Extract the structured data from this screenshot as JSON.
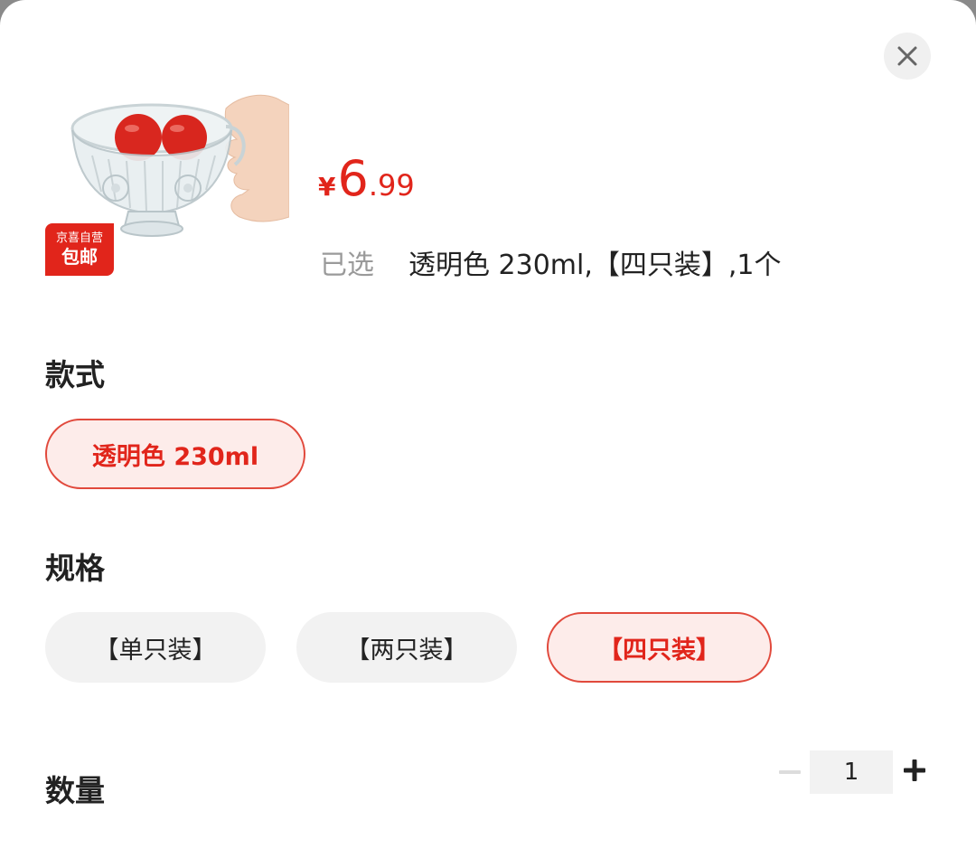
{
  "product": {
    "image_icon": "glass-bowl-with-tomatoes-image",
    "badge_top": "京喜自营",
    "badge_bottom": "包邮",
    "price_currency": "¥",
    "price_integer": "6",
    "price_decimal": ".99"
  },
  "selected": {
    "label": "已选",
    "value": "透明色 230ml,【四只装】,1个"
  },
  "style_section": {
    "title": "款式",
    "options": [
      {
        "label": "透明色 230ml",
        "selected": true
      }
    ]
  },
  "spec_section": {
    "title": "规格",
    "options": [
      {
        "label": "【单只装】",
        "selected": false
      },
      {
        "label": "【两只装】",
        "selected": false
      },
      {
        "label": "【四只装】",
        "selected": true
      }
    ]
  },
  "quantity_section": {
    "title": "数量",
    "value": "1"
  },
  "colors": {
    "accent": "#e1251b",
    "selected_bg": "#fdecea",
    "chip_bg": "#f2f2f2"
  },
  "icons": {
    "close": "close-icon",
    "minus": "minus-icon",
    "plus": "plus-icon"
  }
}
